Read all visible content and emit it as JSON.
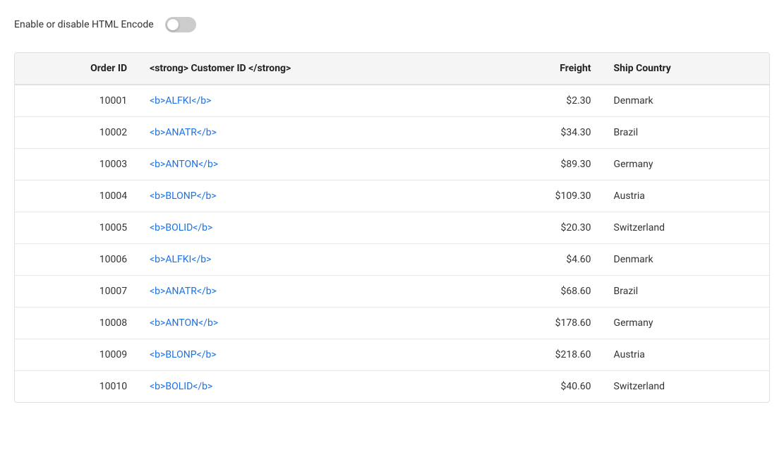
{
  "toggle": {
    "label": "Enable or disable HTML Encode",
    "checked": false
  },
  "table": {
    "columns": [
      {
        "key": "orderid",
        "label": "Order ID",
        "align": "right"
      },
      {
        "key": "customerid",
        "label": "<strong> Customer ID </strong>",
        "align": "left"
      },
      {
        "key": "freight",
        "label": "Freight",
        "align": "right"
      },
      {
        "key": "shipcountry",
        "label": "Ship Country",
        "align": "left"
      }
    ],
    "rows": [
      {
        "orderid": "10001",
        "customerid": "<b>ALFKI</b>",
        "freight": "$2.30",
        "shipcountry": "Denmark"
      },
      {
        "orderid": "10002",
        "customerid": "<b>ANATR</b>",
        "freight": "$34.30",
        "shipcountry": "Brazil"
      },
      {
        "orderid": "10003",
        "customerid": "<b>ANTON</b>",
        "freight": "$89.30",
        "shipcountry": "Germany"
      },
      {
        "orderid": "10004",
        "customerid": "<b>BLONP</b>",
        "freight": "$109.30",
        "shipcountry": "Austria"
      },
      {
        "orderid": "10005",
        "customerid": "<b>BOLID</b>",
        "freight": "$20.30",
        "shipcountry": "Switzerland"
      },
      {
        "orderid": "10006",
        "customerid": "<b>ALFKI</b>",
        "freight": "$4.60",
        "shipcountry": "Denmark"
      },
      {
        "orderid": "10007",
        "customerid": "<b>ANATR</b>",
        "freight": "$68.60",
        "shipcountry": "Brazil"
      },
      {
        "orderid": "10008",
        "customerid": "<b>ANTON</b>",
        "freight": "$178.60",
        "shipcountry": "Germany"
      },
      {
        "orderid": "10009",
        "customerid": "<b>BLONP</b>",
        "freight": "$218.60",
        "shipcountry": "Austria"
      },
      {
        "orderid": "10010",
        "customerid": "<b>BOLID</b>",
        "freight": "$40.60",
        "shipcountry": "Switzerland"
      }
    ]
  }
}
